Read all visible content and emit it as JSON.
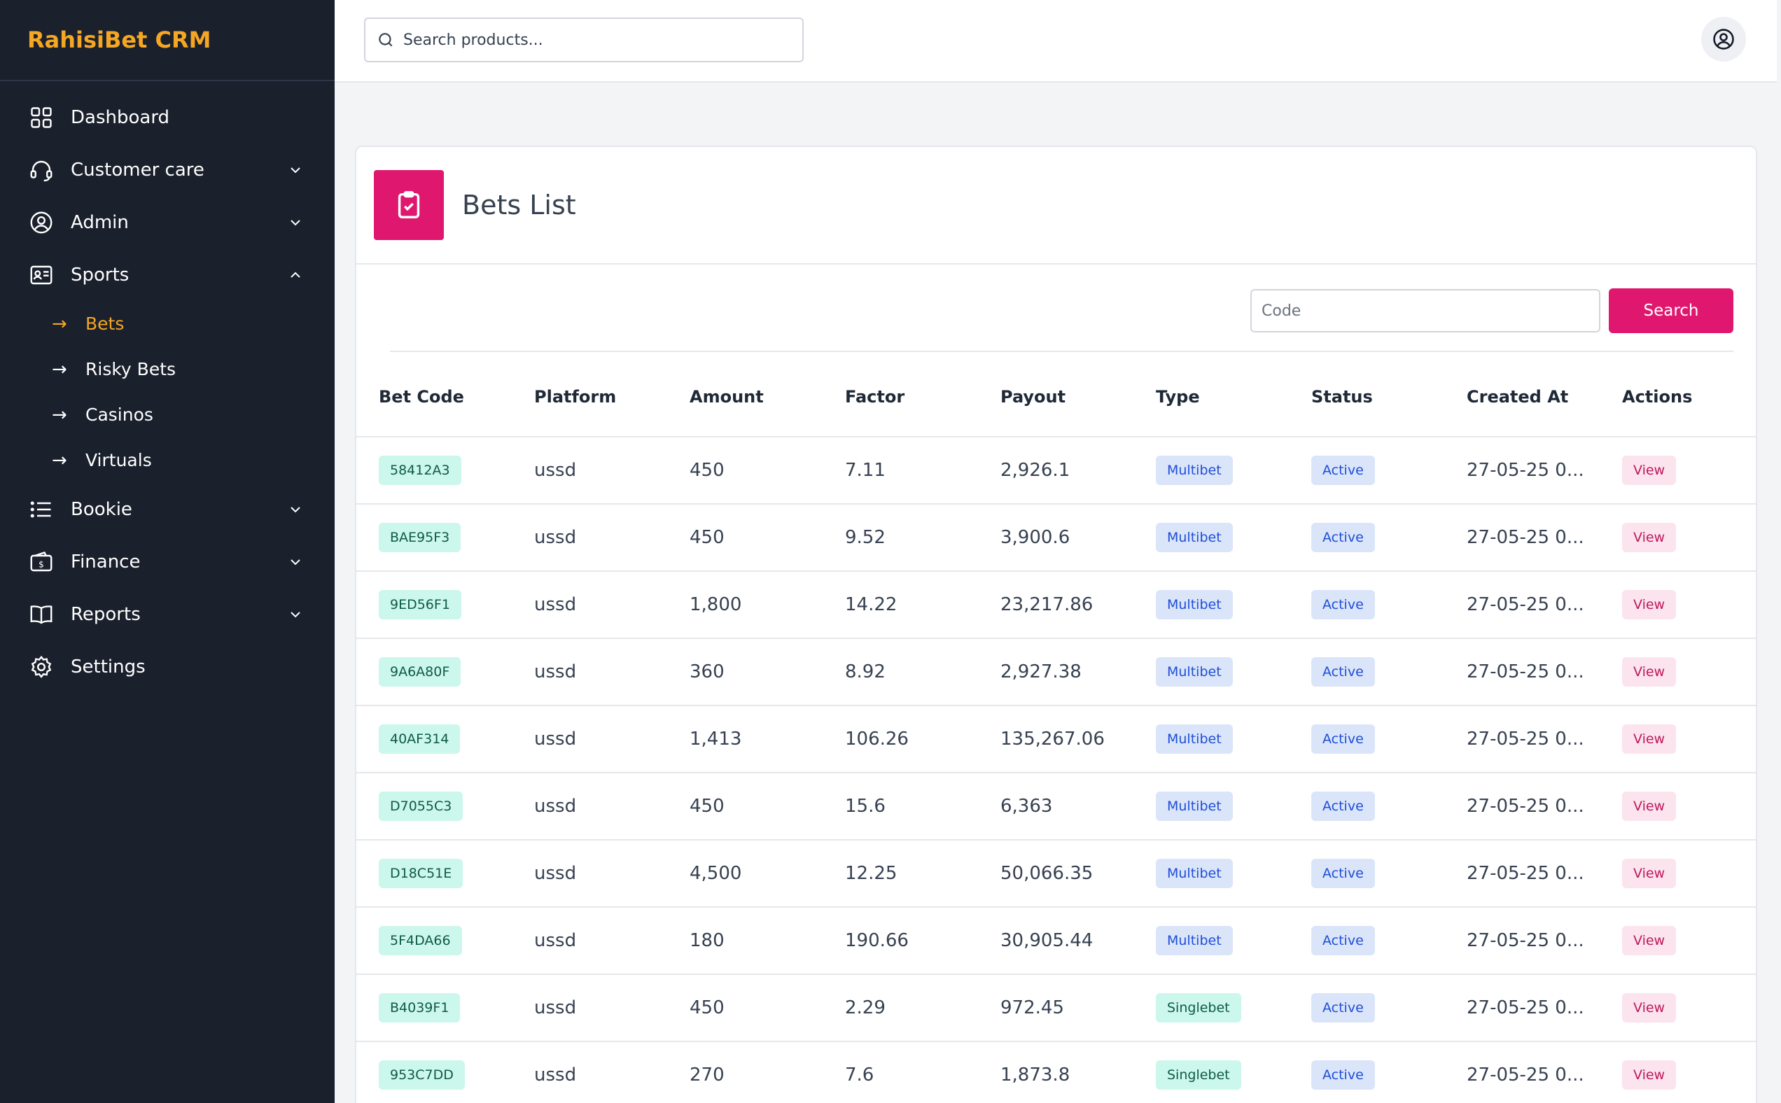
{
  "brand": "RahisiBet CRM",
  "search": {
    "placeholder": "Search products..."
  },
  "sidebar": {
    "items": [
      {
        "label": "Dashboard",
        "icon": "grid-icon"
      },
      {
        "label": "Customer care",
        "icon": "headset-icon"
      },
      {
        "label": "Admin",
        "icon": "user-circle-icon"
      },
      {
        "label": "Sports",
        "icon": "id-card-icon"
      },
      {
        "label": "Bookie",
        "icon": "list-icon"
      },
      {
        "label": "Finance",
        "icon": "wallet-icon"
      },
      {
        "label": "Reports",
        "icon": "book-icon"
      },
      {
        "label": "Settings",
        "icon": "gear-icon"
      }
    ],
    "sports_sub": [
      {
        "label": "Bets",
        "active": true
      },
      {
        "label": "Risky Bets",
        "active": false
      },
      {
        "label": "Casinos",
        "active": false
      },
      {
        "label": "Virtuals",
        "active": false
      }
    ],
    "arrow": "→"
  },
  "page": {
    "title": "Bets List",
    "code_placeholder": "Code",
    "search_button": "Search"
  },
  "table": {
    "columns": [
      "Bet Code",
      "Platform",
      "Amount",
      "Factor",
      "Payout",
      "Type",
      "Status",
      "Created At",
      "Actions"
    ],
    "rows": [
      {
        "code": "58412A3",
        "platform": "ussd",
        "amount": "450",
        "factor": "7.11",
        "payout": "2,926.1",
        "type": "Multibet",
        "status": "Active",
        "created": "27-05-25 0...",
        "action": "View"
      },
      {
        "code": "BAE95F3",
        "platform": "ussd",
        "amount": "450",
        "factor": "9.52",
        "payout": "3,900.6",
        "type": "Multibet",
        "status": "Active",
        "created": "27-05-25 0...",
        "action": "View"
      },
      {
        "code": "9ED56F1",
        "platform": "ussd",
        "amount": "1,800",
        "factor": "14.22",
        "payout": "23,217.86",
        "type": "Multibet",
        "status": "Active",
        "created": "27-05-25 0...",
        "action": "View"
      },
      {
        "code": "9A6A80F",
        "platform": "ussd",
        "amount": "360",
        "factor": "8.92",
        "payout": "2,927.38",
        "type": "Multibet",
        "status": "Active",
        "created": "27-05-25 0...",
        "action": "View"
      },
      {
        "code": "40AF314",
        "platform": "ussd",
        "amount": "1,413",
        "factor": "106.26",
        "payout": "135,267.06",
        "type": "Multibet",
        "status": "Active",
        "created": "27-05-25 0...",
        "action": "View"
      },
      {
        "code": "D7055C3",
        "platform": "ussd",
        "amount": "450",
        "factor": "15.6",
        "payout": "6,363",
        "type": "Multibet",
        "status": "Active",
        "created": "27-05-25 0...",
        "action": "View"
      },
      {
        "code": "D18C51E",
        "platform": "ussd",
        "amount": "4,500",
        "factor": "12.25",
        "payout": "50,066.35",
        "type": "Multibet",
        "status": "Active",
        "created": "27-05-25 0...",
        "action": "View"
      },
      {
        "code": "5F4DA66",
        "platform": "ussd",
        "amount": "180",
        "factor": "190.66",
        "payout": "30,905.44",
        "type": "Multibet",
        "status": "Active",
        "created": "27-05-25 0...",
        "action": "View"
      },
      {
        "code": "B4039F1",
        "platform": "ussd",
        "amount": "450",
        "factor": "2.29",
        "payout": "972.45",
        "type": "Singlebet",
        "status": "Active",
        "created": "27-05-25 0...",
        "action": "View"
      },
      {
        "code": "953C7DD",
        "platform": "ussd",
        "amount": "270",
        "factor": "7.6",
        "payout": "1,873.8",
        "type": "Singlebet",
        "status": "Active",
        "created": "27-05-25 0...",
        "action": "View"
      }
    ]
  },
  "colors": {
    "accent": "#e0176e",
    "brand": "#f5a623",
    "sidebar_bg": "#1a202c"
  }
}
